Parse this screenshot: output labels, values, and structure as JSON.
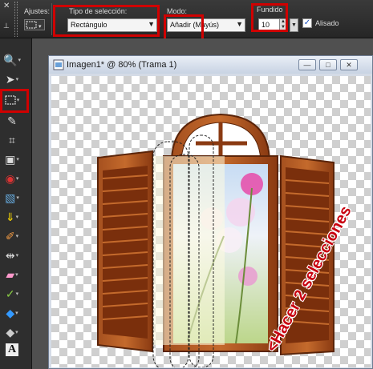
{
  "toolbar": {
    "ajustes_label": "Ajustes:",
    "tipo_label": "Tipo de selección:",
    "tipo_value": "Rectángulo",
    "modo_label": "Modo:",
    "modo_value": "Añadir (Mayús)",
    "fundido_label": "Fundido",
    "fundido_value": "10",
    "alisado_label": "Alisado",
    "alisado_checked": true
  },
  "document": {
    "title": "Imagen1* @  80% (Trama 1)"
  },
  "annotation": {
    "text": "<Hacer 2 selecciones",
    "color": "#c8000f"
  },
  "colors": {
    "highlight": "#d00000",
    "wood": "#8a3a12"
  },
  "icons": [
    "zoom-icon",
    "pick-icon",
    "selection-icon",
    "dropper-icon",
    "crop-icon",
    "move-icon",
    "red-eye-icon",
    "straighten-icon",
    "clone-icon",
    "paint-brush-icon",
    "scratch-remover-icon",
    "eraser-icon",
    "dodge-icon",
    "fill-icon",
    "eraser-icon",
    "text-icon"
  ]
}
